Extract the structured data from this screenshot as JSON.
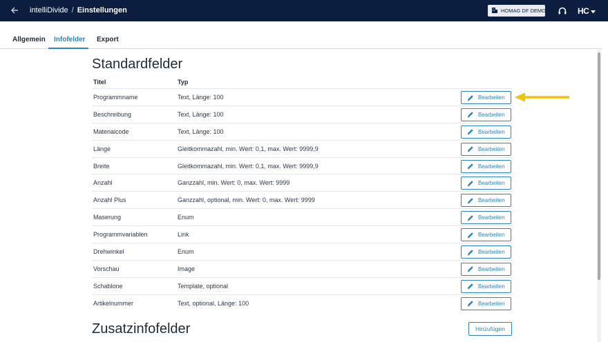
{
  "header": {
    "breadcrumb_app": "intelliDivide",
    "breadcrumb_sep": "/",
    "breadcrumb_page": "Einstellungen",
    "tenant": "HOMAG DF DEMO",
    "logo_text": "HC"
  },
  "tabs": [
    {
      "label": "Allgemein"
    },
    {
      "label": "Infofelder"
    },
    {
      "label": "Export"
    }
  ],
  "active_tab": "Infofelder",
  "standard": {
    "title": "Standardfelder",
    "col_title": "Titel",
    "col_type": "Typ",
    "edit_label": "Bearbeiten",
    "rows": [
      {
        "title": "Programmname",
        "type": "Text, Länge: 100"
      },
      {
        "title": "Beschreibung",
        "type": "Text, Länge: 100"
      },
      {
        "title": "Materialcode",
        "type": "Text, Länge: 100"
      },
      {
        "title": "Länge",
        "type": "Gleitkommazahl, min. Wert: 0,1, max. Wert: 9999,9"
      },
      {
        "title": "Breite",
        "type": "Gleitkommazahl, min. Wert: 0,1, max. Wert: 9999,9"
      },
      {
        "title": "Anzahl",
        "type": "Ganzzahl, min. Wert: 0, max. Wert: 9999"
      },
      {
        "title": "Anzahl Plus",
        "type": "Ganzzahl, optional, min. Wert: 0, max. Wert: 9999"
      },
      {
        "title": "Maserung",
        "type": "Enum"
      },
      {
        "title": "Programmvariablen",
        "type": "Link"
      },
      {
        "title": "Drehwinkel",
        "type": "Enum"
      },
      {
        "title": "Vorschau",
        "type": "Image"
      },
      {
        "title": "Schablone",
        "type": "Template, optional"
      },
      {
        "title": "Artikelnummer",
        "type": "Text, optional, Länge: 100"
      }
    ]
  },
  "extra": {
    "title": "Zusatzinfofelder",
    "add_label": "Hinzufügen"
  },
  "colors": {
    "header_bg": "#0b1e3f",
    "accent": "#2a86b8",
    "arrow": "#f5c000"
  }
}
